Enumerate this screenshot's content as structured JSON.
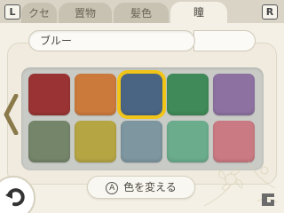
{
  "tabs": [
    {
      "label": "クセ",
      "active": false
    },
    {
      "label": "置物",
      "active": false
    },
    {
      "label": "髪色",
      "active": false
    },
    {
      "label": "瞳",
      "active": true
    }
  ],
  "shoulder_buttons": {
    "left": "L",
    "right": "R"
  },
  "color_name": "ブルー",
  "palette": {
    "colors": [
      "#9a3434",
      "#cc7a3b",
      "#4a6584",
      "#3f8a58",
      "#8d72a1",
      "#74856a",
      "#b6a543",
      "#7d96a0",
      "#6aac8c",
      "#c97a82"
    ],
    "selected_index": 2
  },
  "action": {
    "button_glyph": "A",
    "label": "色を変える"
  },
  "colors": {
    "selection": "#f1c418",
    "background": "#f4f0e5"
  },
  "icons": [
    "chevron-left-icon",
    "back-arrow-icon",
    "flower-decoration",
    "corner-logo-icon"
  ]
}
